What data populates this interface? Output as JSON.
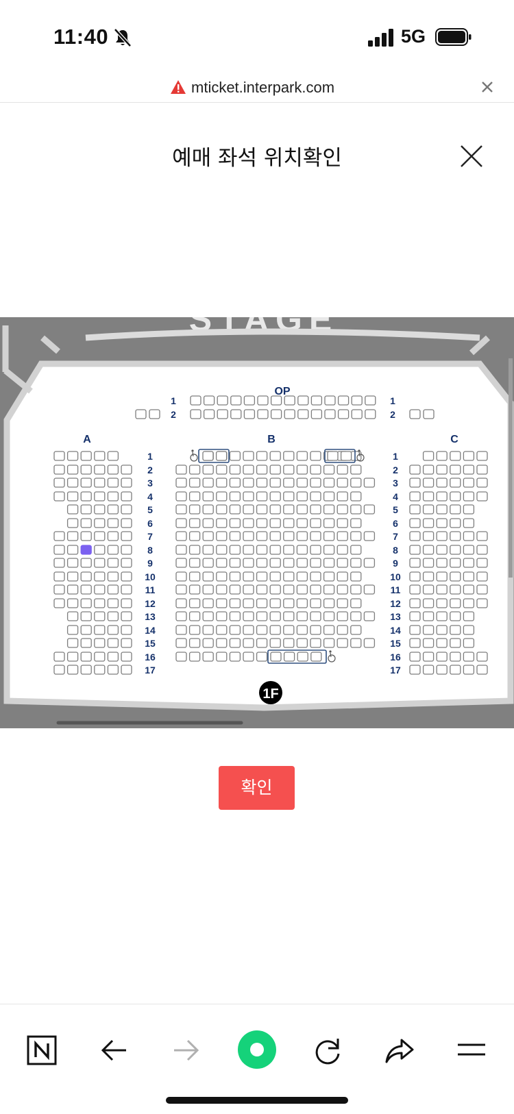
{
  "status_bar": {
    "time": "11:40",
    "network": "5G",
    "icons": [
      "bell-slash-icon",
      "signal-icon",
      "battery-icon"
    ]
  },
  "url_bar": {
    "url": "mticket.interpark.com",
    "icons": [
      "warning-icon",
      "close-icon"
    ]
  },
  "modal": {
    "title": "예매 좌석 위치확인",
    "close_icon": "close-icon",
    "confirm_label": "확인"
  },
  "seatmap": {
    "stage_label": "STAGE",
    "floor_label": "1F",
    "section_labels": {
      "op": "OP",
      "a": "A",
      "b": "B",
      "c": "C"
    },
    "op_rows": [
      "1",
      "2"
    ],
    "rows": [
      "1",
      "2",
      "3",
      "4",
      "5",
      "6",
      "7",
      "8",
      "9",
      "10",
      "11",
      "12",
      "13",
      "14",
      "15",
      "16",
      "17"
    ],
    "selected_seat": {
      "section": "A",
      "row": "8",
      "seat": 3
    },
    "colors": {
      "background": "#808080",
      "floor": "#ffffff",
      "seat_border": "#7d7d7d",
      "seat_selected": "#7b61f0",
      "label": "#14306a",
      "wheelchair_frame": "#2f4f7f"
    }
  },
  "bottom_bar": {
    "icons": [
      "naver-n-icon",
      "back-arrow-icon",
      "forward-arrow-icon",
      "green-dot-icon",
      "reload-icon",
      "share-icon",
      "menu-icon"
    ]
  }
}
